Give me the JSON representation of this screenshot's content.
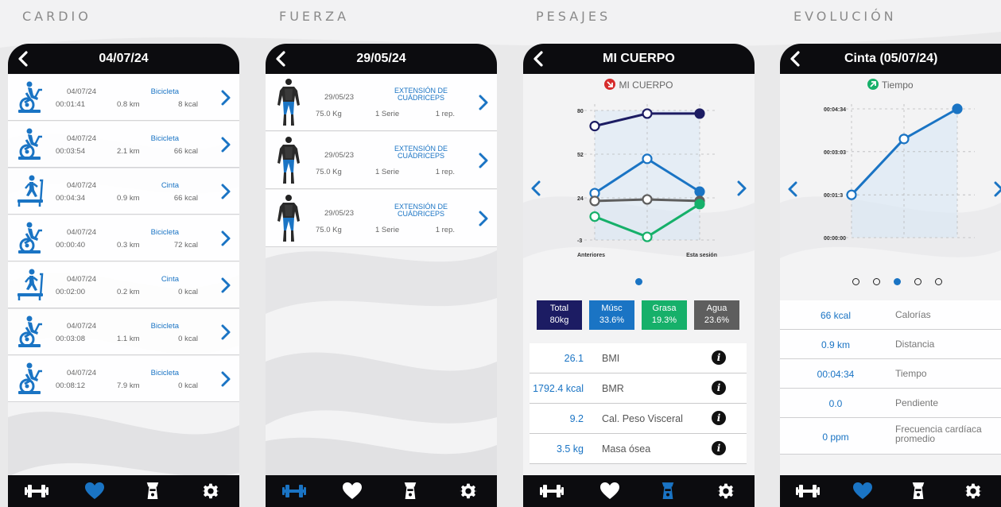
{
  "sections": {
    "cardio": "CARDIO",
    "fuerza": "FUERZA",
    "pesajes": "PESAJES",
    "evolucion": "EVOLUCIÓN"
  },
  "colors": {
    "accent": "#1a74c4",
    "bar": "#0c0c0f",
    "navy": "#1c1c63",
    "green": "#16b06a",
    "gray": "#5e5e5e"
  },
  "cardio": {
    "title": "04/07/24",
    "rows": [
      {
        "icon": "bike-icon",
        "date": "04/07/24",
        "time": "00:01:41",
        "type": "Bicicleta",
        "dist": "0.8 km",
        "kcal": "8 kcal"
      },
      {
        "icon": "bike-icon",
        "date": "04/07/24",
        "time": "00:03:54",
        "type": "Bicicleta",
        "dist": "2.1 km",
        "kcal": "66 kcal"
      },
      {
        "icon": "treadmill-icon",
        "date": "04/07/24",
        "time": "00:04:34",
        "type": "Cinta",
        "dist": "0.9 km",
        "kcal": "66 kcal"
      },
      {
        "icon": "bike-icon",
        "date": "04/07/24",
        "time": "00:00:40",
        "type": "Bicicleta",
        "dist": "0.3 km",
        "kcal": "72 kcal"
      },
      {
        "icon": "treadmill-icon",
        "date": "04/07/24",
        "time": "00:02:00",
        "type": "Cinta",
        "dist": "0.2 km",
        "kcal": "0 kcal"
      },
      {
        "icon": "bike-icon",
        "date": "04/07/24",
        "time": "00:03:08",
        "type": "Bicicleta",
        "dist": "1.1 km",
        "kcal": "0 kcal"
      },
      {
        "icon": "bike-icon",
        "date": "04/07/24",
        "time": "00:08:12",
        "type": "Bicicleta",
        "dist": "7.9 km",
        "kcal": "0 kcal"
      }
    ]
  },
  "fuerza": {
    "title": "29/05/24",
    "rows": [
      {
        "icon": "body-icon",
        "date": "29/05/23",
        "name": "EXTENSIÓN DE\nCUÁDRICEPS",
        "weight": "75.0 Kg",
        "series": "1 Serie",
        "reps": "1 rep."
      },
      {
        "icon": "body-icon",
        "date": "29/05/23",
        "name": "EXTENSIÓN DE\nCUÁDRICEPS",
        "weight": "75.0 Kg",
        "series": "1 Serie",
        "reps": "1 rep."
      },
      {
        "icon": "body-icon",
        "date": "29/05/23",
        "name": "EXTENSIÓN DE\nCUÁDRICEPS",
        "weight": "75.0 Kg",
        "series": "1 Serie",
        "reps": "1 rep."
      }
    ]
  },
  "pesajes": {
    "title": "MI CUERPO",
    "chart_title": "MI CUERPO",
    "chart_data": {
      "type": "line",
      "categories": [
        "Anteriores",
        "Esta sesión"
      ],
      "x": [
        0,
        1,
        2
      ],
      "yticks": [
        "80",
        "52",
        "24",
        "-3"
      ],
      "ylim": [
        -3,
        80
      ],
      "series": [
        {
          "color": "#1c1c63",
          "values": [
            70,
            78,
            78
          ]
        },
        {
          "color": "#1a74c4",
          "values": [
            27,
            49,
            28
          ]
        },
        {
          "color": "#5e5e5e",
          "values": [
            22,
            23,
            22
          ]
        },
        {
          "color": "#16b06a",
          "values": [
            12,
            -1,
            20
          ]
        }
      ]
    },
    "boxes": [
      {
        "label": "Total",
        "value": "80kg",
        "color": "#1c1c63"
      },
      {
        "label": "Músc",
        "value": "33.6%",
        "color": "#1a74c4"
      },
      {
        "label": "Grasa",
        "value": "19.3%",
        "color": "#16b06a"
      },
      {
        "label": "Agua",
        "value": "23.6%",
        "color": "#5e5e5e"
      }
    ],
    "metrics": [
      {
        "value": "26.1",
        "label": "BMI",
        "info": "i"
      },
      {
        "value": "1792.4 kcal",
        "label": "BMR",
        "info": "i"
      },
      {
        "value": "9.2",
        "label": "Cal. Peso Visceral",
        "info": "i"
      },
      {
        "value": "3.5 kg",
        "label": "Masa ósea",
        "info": "i"
      }
    ]
  },
  "evolucion": {
    "title": "Cinta (05/07/24)",
    "chart_title": "Tiempo",
    "chart_data": {
      "type": "line",
      "yticks": [
        "00:04:34",
        "00:03:03",
        "00:01:3",
        "00:00:00"
      ],
      "ylim": [
        0,
        274
      ],
      "x": [
        0,
        1,
        2
      ],
      "values": [
        91,
        210,
        274
      ],
      "series_color": "#1a74c4"
    },
    "page_dots": 5,
    "active_dot": 2,
    "rows": [
      {
        "value": "66 kcal",
        "label": "Calorías"
      },
      {
        "value": "0.9 km",
        "label": "Distancia"
      },
      {
        "value": "00:04:34",
        "label": "Tiempo"
      },
      {
        "value": "0.0",
        "label": "Pendiente"
      },
      {
        "value": "0 ppm",
        "label": "Frecuencia cardíaca\npromedio"
      }
    ]
  },
  "tabbar": [
    {
      "name": "strength",
      "icon": "dumbbell-icon"
    },
    {
      "name": "cardio",
      "icon": "heart-icon"
    },
    {
      "name": "weighing",
      "icon": "scale-icon"
    },
    {
      "name": "settings",
      "icon": "gear-icon"
    }
  ],
  "active_tabs": {
    "p1": 1,
    "p2": 0,
    "p3": 2,
    "p4": 1
  }
}
